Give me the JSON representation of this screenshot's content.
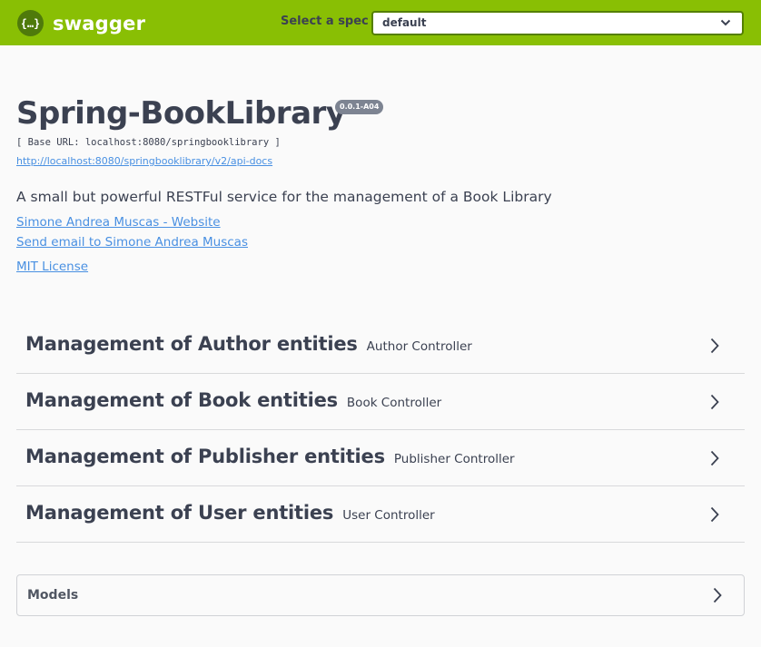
{
  "topbar": {
    "brand": "swagger",
    "logo_icon": "swagger-braces-icon",
    "spec_label": "Select a spec",
    "spec_selected": "default",
    "bg_color": "#89bf04"
  },
  "info": {
    "title": "Spring-BookLibrary",
    "version": "0.0.1-A04",
    "base_url": "[ Base URL: localhost:8080/springbooklibrary ]",
    "docs_url": "http://localhost:8080/springbooklibrary/v2/api-docs",
    "description": "A small but powerful RESTFul service for the management of a Book Library",
    "website_link": "Simone Andrea Muscas - Website",
    "email_link": "Send email to Simone Andrea Muscas",
    "license_link": "MIT License"
  },
  "tags": [
    {
      "name": "Management of Author entities",
      "description": "Author Controller"
    },
    {
      "name": "Management of Book entities",
      "description": "Book Controller"
    },
    {
      "name": "Management of Publisher entities",
      "description": "Publisher Controller"
    },
    {
      "name": "Management of User entities",
      "description": "User Controller"
    }
  ],
  "models": {
    "title": "Models"
  },
  "colors": {
    "link": "#4990e2",
    "text": "#3b4151",
    "badge": "#7d8492"
  }
}
